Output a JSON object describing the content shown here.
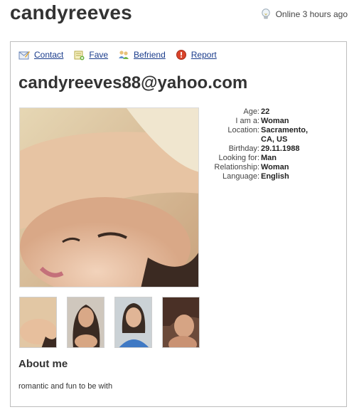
{
  "profile": {
    "username": "candyreeves",
    "online_status": "Online 3 hours ago",
    "email_heading": "candyreeves88@yahoo.com"
  },
  "actions": [
    {
      "label": "Contact",
      "icon": "contact-icon"
    },
    {
      "label": "Fave",
      "icon": "fave-icon"
    },
    {
      "label": "Befriend",
      "icon": "befriend-icon"
    },
    {
      "label": "Report",
      "icon": "report-icon"
    }
  ],
  "details": [
    {
      "label": "Age:",
      "value": "22"
    },
    {
      "label": "I am a:",
      "value": "Woman"
    },
    {
      "label": "Location:",
      "value": "Sacramento, CA, US"
    },
    {
      "label": "Birthday:",
      "value": "29.11.1988"
    },
    {
      "label": "Looking for:",
      "value": "Man"
    },
    {
      "label": "Relationship:",
      "value": "Woman"
    },
    {
      "label": "Language:",
      "value": "English"
    }
  ],
  "about": {
    "heading": "About me",
    "text": "romantic and fun to be with"
  },
  "colors": {
    "link": "#1a3c8c",
    "panel_border": "#bdbdbd",
    "report": "#d9442b"
  }
}
